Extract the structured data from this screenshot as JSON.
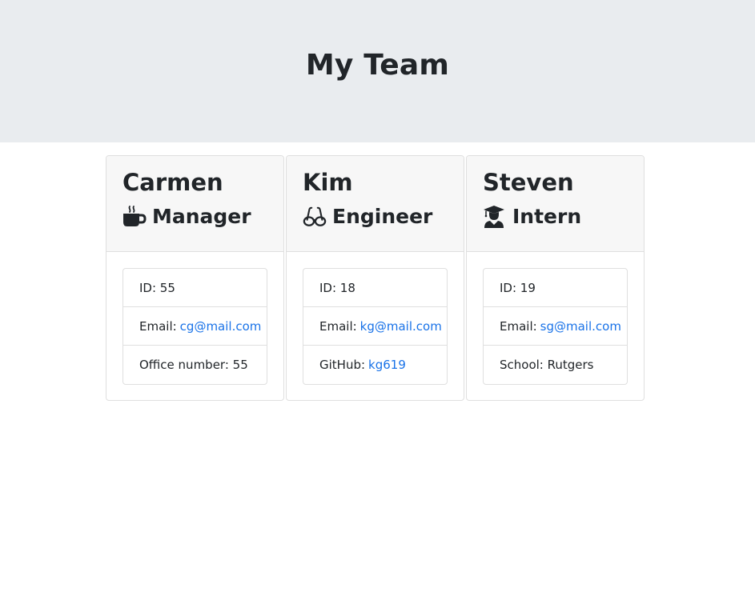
{
  "header": {
    "title": "My Team"
  },
  "team": [
    {
      "name": "Carmen",
      "role": "Manager",
      "icon": "mug-icon",
      "id_text": "ID: 55",
      "email_label": "Email:",
      "email": "cg@mail.com",
      "extra_label": "Office number: 55",
      "extra_link": ""
    },
    {
      "name": "Kim",
      "role": "Engineer",
      "icon": "glasses-icon",
      "id_text": "ID: 18",
      "email_label": "Email:",
      "email": "kg@mail.com",
      "extra_label": "GitHub:",
      "extra_link": "kg619"
    },
    {
      "name": "Steven",
      "role": "Intern",
      "icon": "graduate-icon",
      "id_text": "ID: 19",
      "email_label": "Email:",
      "email": "sg@mail.com",
      "extra_label": "School: Rutgers",
      "extra_link": ""
    }
  ],
  "colors": {
    "header_bg": "#e9ecef",
    "link": "#1a73e8",
    "text": "#212529"
  }
}
